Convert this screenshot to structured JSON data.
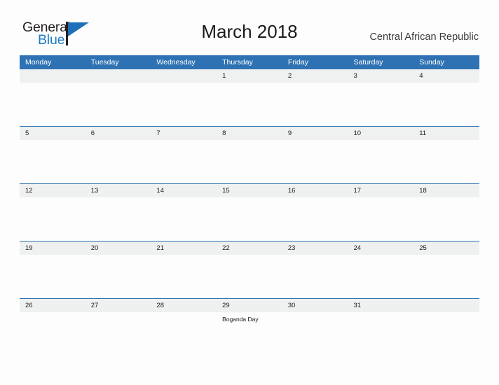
{
  "brand": {
    "word_one": "General",
    "word_two": "Blue",
    "flag_icon": "triangle-flag-icon",
    "accent_color": "#1d6fb8"
  },
  "header": {
    "title": "March 2018",
    "country": "Central African Republic"
  },
  "theme": {
    "header_blue": "#2e72b3",
    "date_band": "#eff0f0",
    "page_bg": "#fdfdfd",
    "text": "#1a1a1a"
  },
  "calendar": {
    "weekday_headers": [
      "Monday",
      "Tuesday",
      "Wednesday",
      "Thursday",
      "Friday",
      "Saturday",
      "Sunday"
    ],
    "weeks": [
      [
        {
          "day": "",
          "holiday": ""
        },
        {
          "day": "",
          "holiday": ""
        },
        {
          "day": "",
          "holiday": ""
        },
        {
          "day": "1",
          "holiday": ""
        },
        {
          "day": "2",
          "holiday": ""
        },
        {
          "day": "3",
          "holiday": ""
        },
        {
          "day": "4",
          "holiday": ""
        }
      ],
      [
        {
          "day": "5",
          "holiday": ""
        },
        {
          "day": "6",
          "holiday": ""
        },
        {
          "day": "7",
          "holiday": ""
        },
        {
          "day": "8",
          "holiday": ""
        },
        {
          "day": "9",
          "holiday": ""
        },
        {
          "day": "10",
          "holiday": ""
        },
        {
          "day": "11",
          "holiday": ""
        }
      ],
      [
        {
          "day": "12",
          "holiday": ""
        },
        {
          "day": "13",
          "holiday": ""
        },
        {
          "day": "14",
          "holiday": ""
        },
        {
          "day": "15",
          "holiday": ""
        },
        {
          "day": "16",
          "holiday": ""
        },
        {
          "day": "17",
          "holiday": ""
        },
        {
          "day": "18",
          "holiday": ""
        }
      ],
      [
        {
          "day": "19",
          "holiday": ""
        },
        {
          "day": "20",
          "holiday": ""
        },
        {
          "day": "21",
          "holiday": ""
        },
        {
          "day": "22",
          "holiday": ""
        },
        {
          "day": "23",
          "holiday": ""
        },
        {
          "day": "24",
          "holiday": ""
        },
        {
          "day": "25",
          "holiday": ""
        }
      ],
      [
        {
          "day": "26",
          "holiday": ""
        },
        {
          "day": "27",
          "holiday": ""
        },
        {
          "day": "28",
          "holiday": ""
        },
        {
          "day": "29",
          "holiday": "Boganda Day"
        },
        {
          "day": "30",
          "holiday": ""
        },
        {
          "day": "31",
          "holiday": ""
        },
        {
          "day": "",
          "holiday": ""
        }
      ]
    ]
  }
}
